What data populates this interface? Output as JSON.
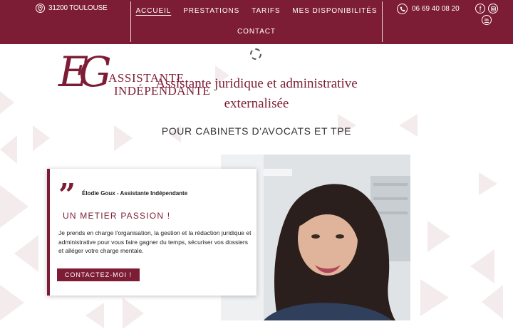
{
  "header": {
    "location": "31200 TOULOUSE",
    "phone": "06 69 40 08 20",
    "nav": [
      {
        "label": "ACCUEIL",
        "active": true
      },
      {
        "label": "PRESTATIONS",
        "active": false
      },
      {
        "label": "TARIFS",
        "active": false
      },
      {
        "label": "MES DISPONIBILITÉS",
        "active": false
      },
      {
        "label": "CONTACT",
        "active": false
      }
    ],
    "social": [
      "facebook-icon",
      "instagram-icon",
      "linkedin-icon"
    ]
  },
  "logo": {
    "monogram": "EG",
    "line1": "ASSISTANTE",
    "line2": "INDÉPENDANTE"
  },
  "hero": {
    "headline_line1": "Assistante juridique et administrative",
    "headline_line2": "externalisée",
    "subtitle": "POUR CABINETS D'AVOCATS ET TPE"
  },
  "card": {
    "author": "Élodie Goux - Assistante Indépendante",
    "title": "UN METIER PASSION !",
    "description": "Je prends en charge l'organisation, la gestion et la rédaction juridique et administrative pour vous faire gagner du temps, sécuriser vos dossiers et alléger votre charge mentale.",
    "cta_label": "CONTACTEZ-MOI !"
  },
  "colors": {
    "brand": "#7d1d35",
    "pattern": "#f4ebed"
  }
}
